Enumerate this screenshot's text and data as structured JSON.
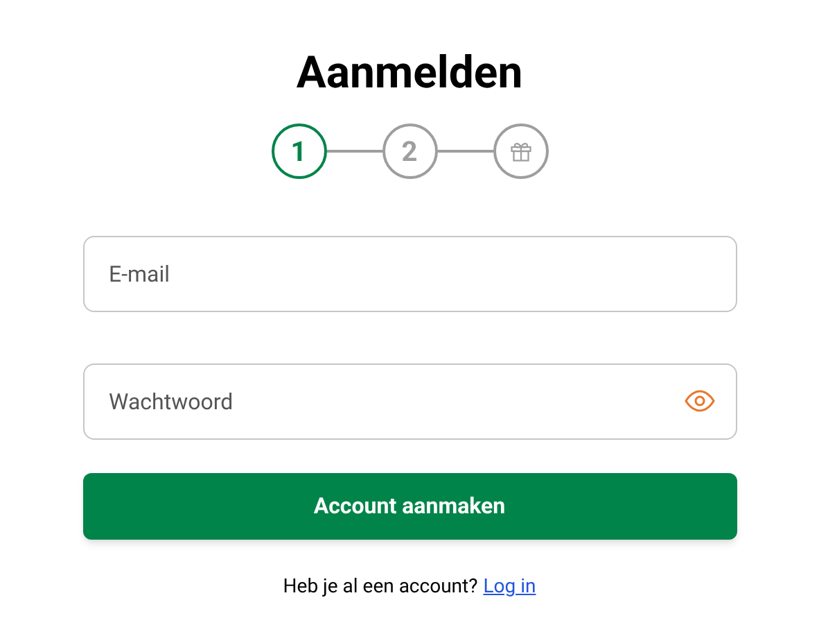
{
  "title": "Aanmelden",
  "steps": [
    {
      "kind": "number",
      "label": "1",
      "selected": true
    },
    {
      "kind": "number",
      "label": "2",
      "selected": false
    },
    {
      "kind": "gift",
      "selected": false
    }
  ],
  "fields": [
    {
      "kind": "text",
      "placeholder": "E-mail"
    },
    {
      "kind": "password",
      "placeholder": "Wachtwoord"
    }
  ],
  "submit_button": "Account aanmaken",
  "footer": {
    "text": "Heb je al een account?",
    "link": "Log in"
  }
}
